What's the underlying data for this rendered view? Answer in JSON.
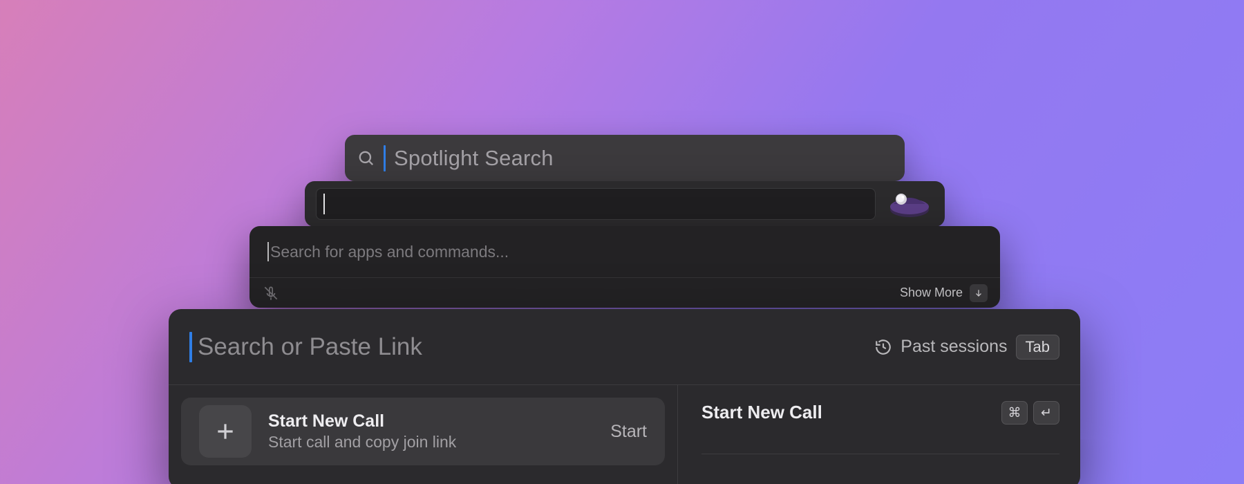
{
  "spotlight": {
    "placeholder": "Spotlight Search"
  },
  "alfred": {
    "value": ""
  },
  "raycast": {
    "placeholder": "Search for apps and commands...",
    "show_more_label": "Show More"
  },
  "launcher": {
    "placeholder": "Search or Paste Link",
    "past_sessions_label": "Past sessions",
    "tab_key_label": "Tab",
    "card": {
      "title": "Start New Call",
      "subtitle": "Start call and copy join link",
      "action": "Start"
    },
    "detail": {
      "title": "Start New Call",
      "shortcut_cmd": "⌘",
      "shortcut_enter": "↵"
    }
  }
}
